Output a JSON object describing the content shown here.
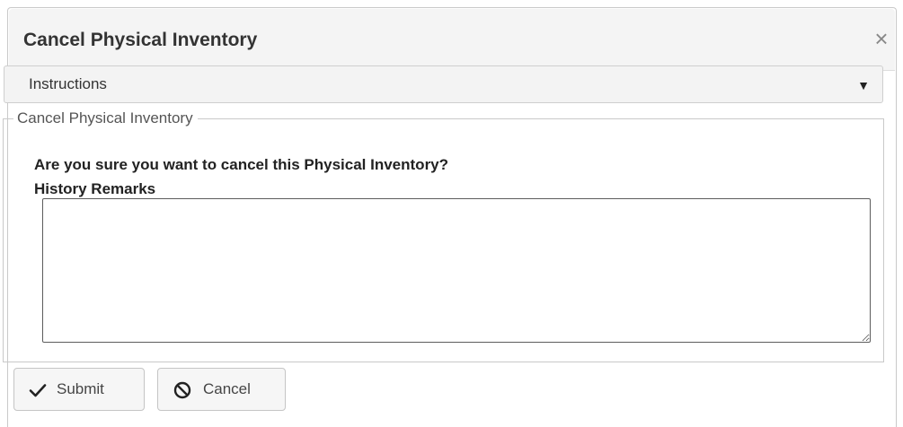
{
  "dialog": {
    "title": "Cancel Physical Inventory",
    "close_symbol": "×"
  },
  "instructions": {
    "label": "Instructions",
    "toggle_symbol": "▼"
  },
  "form": {
    "legend": "Cancel Physical Inventory",
    "question": "Are you sure you want to cancel this Physical Inventory?",
    "remarks_label": "History Remarks",
    "remarks_value": ""
  },
  "buttons": {
    "submit_label": "Submit",
    "submit_icon": "checkmark-icon",
    "cancel_label": "Cancel",
    "cancel_icon": "cancel-circle-icon"
  },
  "colors": {
    "title_text": "#333333",
    "header_bg": "#f4f4f4",
    "border": "#c9c9c9",
    "button_bg": "#f6f6f6"
  }
}
